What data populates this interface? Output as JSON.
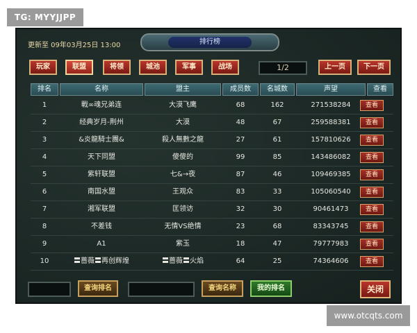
{
  "watermarks": {
    "top_left": "TG: MYYJJPP",
    "bottom_right": "www.otcqts.com"
  },
  "header": {
    "updated": "更新至 09年03月25日 13:00",
    "title": "排行榜"
  },
  "tabs": [
    {
      "label": "玩家",
      "active": false
    },
    {
      "label": "联盟",
      "active": true
    },
    {
      "label": "将领",
      "active": false
    },
    {
      "label": "城池",
      "active": false
    },
    {
      "label": "军事",
      "active": false
    },
    {
      "label": "战场",
      "active": false
    }
  ],
  "pagination": {
    "page": "1/2",
    "prev": "上一页",
    "next": "下一页"
  },
  "table": {
    "columns": [
      "排名",
      "名称",
      "盟主",
      "成员数",
      "名城数",
      "声望",
      "查看"
    ],
    "rows": [
      {
        "rank": "1",
        "name": "戰∞魂兄弟连",
        "leader": "大漠飞鹰",
        "members": "68",
        "cities": "162",
        "prestige": "271538284",
        "view": "查看"
      },
      {
        "rank": "2",
        "name": "经典岁月-荆州",
        "leader": "大漠",
        "members": "48",
        "cities": "67",
        "prestige": "259588381",
        "view": "查看"
      },
      {
        "rank": "3",
        "name": "&炎龍騎士團&",
        "leader": "殺人無數之龍",
        "members": "27",
        "cities": "61",
        "prestige": "157810626",
        "view": "查看"
      },
      {
        "rank": "4",
        "name": "天下同盟",
        "leader": "傻傻的",
        "members": "99",
        "cities": "85",
        "prestige": "143486082",
        "view": "查看"
      },
      {
        "rank": "5",
        "name": "紫轩联盟",
        "leader": "七&→夜",
        "members": "87",
        "cities": "46",
        "prestige": "109469385",
        "view": "查看"
      },
      {
        "rank": "6",
        "name": "南国水盟",
        "leader": "王观众",
        "members": "83",
        "cities": "33",
        "prestige": "105060540",
        "view": "查看"
      },
      {
        "rank": "7",
        "name": "湘军联盟",
        "leader": "匡领访",
        "members": "32",
        "cities": "30",
        "prestige": "90461473",
        "view": "查看"
      },
      {
        "rank": "8",
        "name": "不差钱",
        "leader": "无情VS绝情",
        "members": "23",
        "cities": "68",
        "prestige": "83343745",
        "view": "查看"
      },
      {
        "rank": "9",
        "name": "A1",
        "leader": "紫玉",
        "members": "18",
        "cities": "47",
        "prestige": "79777983",
        "view": "查看"
      },
      {
        "rank": "10",
        "name": "〓蔷薇〓再创辉煌",
        "leader": "〓蔷薇〓火焰",
        "members": "64",
        "cities": "25",
        "prestige": "74364606",
        "view": "查看"
      }
    ]
  },
  "footer": {
    "query_rank_label": "查询排名",
    "query_name_label": "查询名称",
    "my_rank_label": "我的排名",
    "close_label": "关闭",
    "rank_input_value": "",
    "name_input_value": ""
  }
}
